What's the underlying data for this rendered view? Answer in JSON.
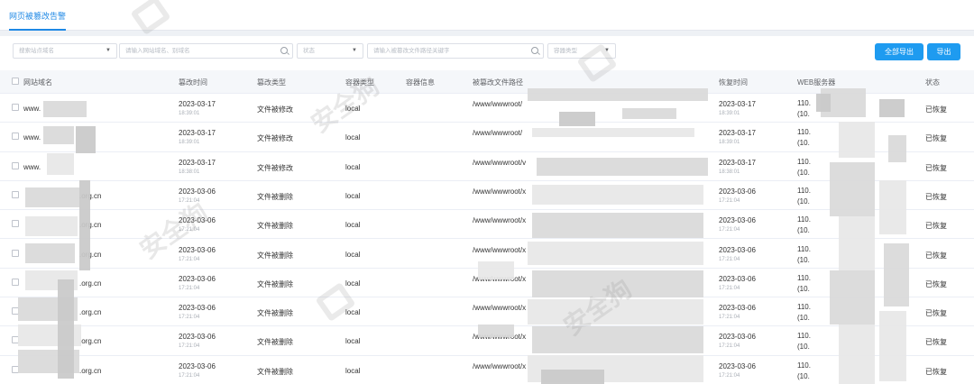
{
  "tab": {
    "label": "网页被篡改告警"
  },
  "filters": {
    "site_select": "搜索站点域名",
    "site_input": "请输入网站域名、别域名",
    "status_select": "状态",
    "path_input": "请输入被篡改文件路径关键字",
    "container_select": "容器类型",
    "export_all": "全部导出",
    "export": "导出"
  },
  "columns": [
    "网站域名",
    "篡改时间",
    "篡改类型",
    "容器类型",
    "容器信息",
    "被篡改文件路径",
    "恢复时间",
    "WEB服务器",
    "状态"
  ],
  "rows": [
    {
      "domain": "www.",
      "date": "2023-03-17",
      "time": "18:39:01",
      "type": "文件被修改",
      "container": "local",
      "path": "/www/wwwroot/",
      "rdate": "2023-03-17",
      "rtime": "18:39:01",
      "server": "110.",
      "server2": "(10.",
      "status": "已恢复"
    },
    {
      "domain": "www.",
      "date": "2023-03-17",
      "time": "18:39:01",
      "type": "文件被修改",
      "container": "local",
      "path": "/www/wwwroot/",
      "rdate": "2023-03-17",
      "rtime": "18:39:01",
      "server": "110.",
      "server2": "(10.",
      "status": "已恢复"
    },
    {
      "domain": "www.",
      "date": "2023-03-17",
      "time": "18:38:01",
      "type": "文件被修改",
      "container": "local",
      "path": "/www/wwwroot/v",
      "rdate": "2023-03-17",
      "rtime": "18:38:01",
      "server": "110.",
      "server2": "(10.",
      "status": "已恢复"
    },
    {
      "domain": ".org.cn",
      "date": "2023-03-06",
      "time": "17:21:04",
      "type": "文件被删除",
      "container": "local",
      "path": "/www/wwwroot/x",
      "rdate": "2023-03-06",
      "rtime": "17:21:04",
      "server": "110.",
      "server2": "(10.",
      "status": "已恢复"
    },
    {
      "domain": ".org.cn",
      "date": "2023-03-06",
      "time": "17:21:04",
      "type": "文件被删除",
      "container": "local",
      "path": "/www/wwwroot/x",
      "rdate": "2023-03-06",
      "rtime": "17:21:04",
      "server": "110.",
      "server2": "(10.",
      "status": "已恢复"
    },
    {
      "domain": ".org.cn",
      "date": "2023-03-06",
      "time": "17:21:04",
      "type": "文件被删除",
      "container": "local",
      "path": "/www/wwwroot/x",
      "rdate": "2023-03-06",
      "rtime": "17:21:04",
      "server": "110.",
      "server2": "(10.",
      "status": "已恢复"
    },
    {
      "domain": ".org.cn",
      "date": "2023-03-06",
      "time": "17:21:04",
      "type": "文件被删除",
      "container": "local",
      "path": "/www/wwwroot/x",
      "rdate": "2023-03-06",
      "rtime": "17:21:04",
      "server": "110.",
      "server2": "(10.",
      "status": "已恢复"
    },
    {
      "domain": ".org.cn",
      "date": "2023-03-06",
      "time": "17:21:04",
      "type": "文件被删除",
      "container": "local",
      "path": "/www/wwwroot/x",
      "rdate": "2023-03-06",
      "rtime": "17:21:04",
      "server": "110.",
      "server2": "(10.",
      "status": "已恢复"
    },
    {
      "domain": ".org.cn",
      "date": "2023-03-06",
      "time": "17:21:04",
      "type": "文件被删除",
      "container": "local",
      "path": "/www/wwwroot/x",
      "rdate": "2023-03-06",
      "rtime": "17:21:04",
      "server": "110.",
      "server2": "(10.",
      "status": "已恢复"
    },
    {
      "domain": ".org.cn",
      "date": "2023-03-06",
      "time": "17:21:04",
      "type": "文件被删除",
      "container": "local",
      "path": "/www/wwwroot/x",
      "rdate": "2023-03-06",
      "rtime": "17:21:04",
      "server": "110.",
      "server2": "(10.",
      "status": "已恢复"
    }
  ],
  "watermark": "安全狗",
  "colors": {
    "accent": "#1e9bf0",
    "header_bg": "#f5f7fa"
  }
}
